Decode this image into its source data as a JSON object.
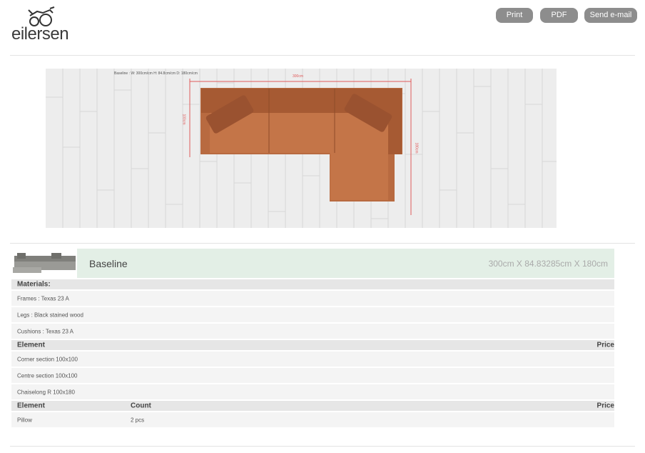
{
  "header": {
    "logo_text": "eilersen",
    "buttons": {
      "print": "Print",
      "pdf": "PDF",
      "email": "Send e-mail"
    }
  },
  "plan": {
    "dimension_label": "Baseline : W: 300cm/cm H: 84.8cm/cm D: 180cm/cm",
    "width_label": "300cm",
    "depth_left_label": "100cm",
    "depth_right_label": "180cm"
  },
  "product": {
    "name": "Baseline",
    "dimensions": "300cm X 84.83285cm X 180cm"
  },
  "materials": {
    "header": "Materials:",
    "items": [
      "Frames : Texas 23 A",
      "Legs : Black stained wood",
      "Cushions : Texas 23 A"
    ]
  },
  "elements": {
    "header_element": "Element",
    "header_price": "Price",
    "items": [
      "Corner section 100x100",
      "Centre section 100x100",
      "Chaiselong R 100x180"
    ]
  },
  "accessories": {
    "header_element": "Element",
    "header_count": "Count",
    "header_price": "Price",
    "items": [
      {
        "name": "Pillow",
        "count": "2 pcs"
      }
    ]
  },
  "colors": {
    "sofa": "#b86a40",
    "button": "#8d8d8d",
    "product_bar": "#e3efe6",
    "dimension_line": "#e05a5a"
  }
}
